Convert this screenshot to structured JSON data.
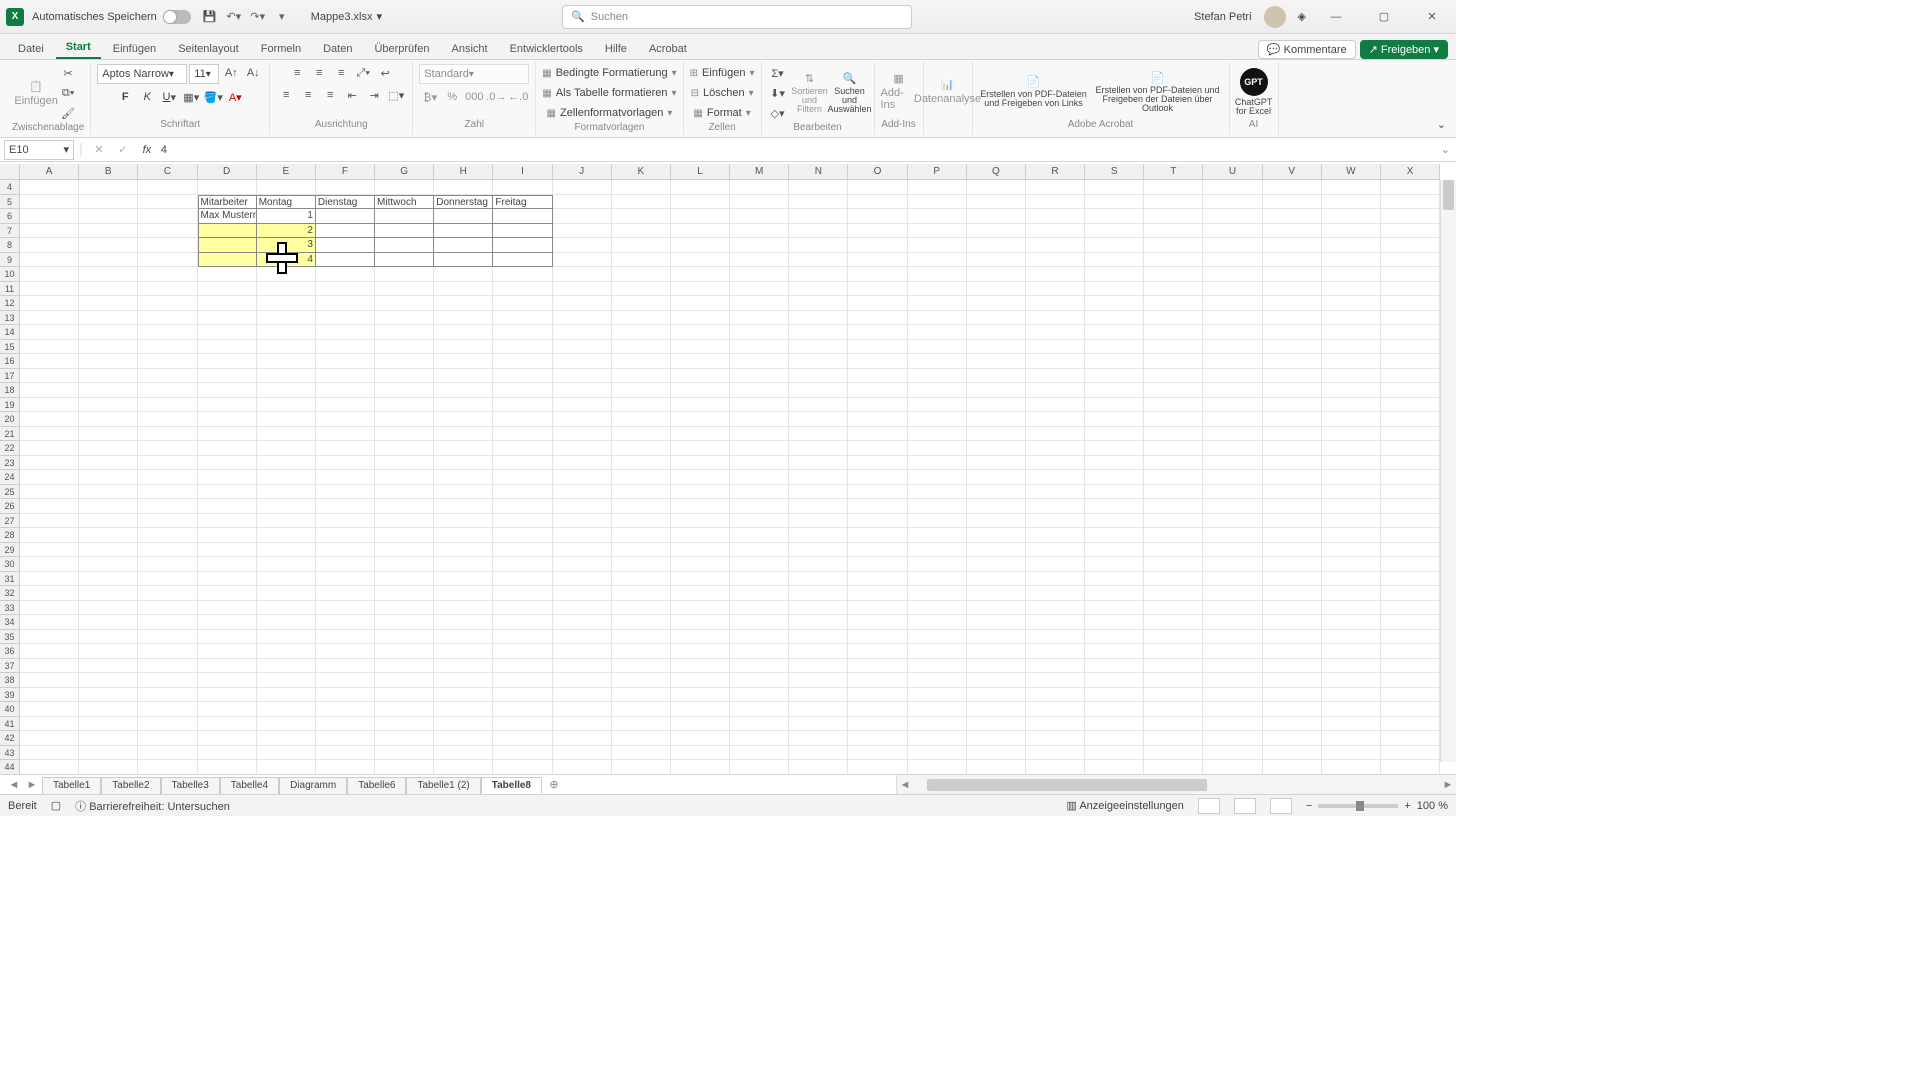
{
  "titlebar": {
    "autosave": "Automatisches Speichern",
    "docname": "Mappe3.xlsx",
    "search_placeholder": "Suchen",
    "user": "Stefan Petri"
  },
  "tabs": {
    "items": [
      "Datei",
      "Start",
      "Einfügen",
      "Seitenlayout",
      "Formeln",
      "Daten",
      "Überprüfen",
      "Ansicht",
      "Entwicklertools",
      "Hilfe",
      "Acrobat"
    ],
    "active": 1,
    "comments": "Kommentare",
    "share": "Freigeben"
  },
  "ribbon": {
    "clipboard": {
      "label": "Zwischenablage",
      "paste": "Einfügen"
    },
    "font": {
      "label": "Schriftart",
      "name": "Aptos Narrow",
      "size": "11"
    },
    "align": {
      "label": "Ausrichtung"
    },
    "number": {
      "label": "Zahl",
      "format": "Standard"
    },
    "styles": {
      "label": "Formatvorlagen",
      "cond": "Bedingte Formatierung",
      "asTable": "Als Tabelle formatieren",
      "cellStyles": "Zellenformatvorlagen"
    },
    "cells": {
      "label": "Zellen",
      "insert": "Einfügen",
      "delete": "Löschen",
      "format": "Format"
    },
    "editing": {
      "label": "Bearbeiten",
      "sortFilter": "Sortieren und Filtern",
      "findSelect": "Suchen und Auswählen"
    },
    "addins": {
      "label": "Add-Ins",
      "addins": "Add-Ins"
    },
    "analysis": {
      "label": "",
      "data": "Datenanalyse"
    },
    "acrobat": {
      "label": "Adobe Acrobat",
      "pdf1": "Erstellen von PDF-Dateien und Freigeben von Links",
      "pdf2": "Erstellen von PDF-Dateien und Freigeben der Dateien über Outlook"
    },
    "ai": {
      "label": "AI",
      "chatgpt": "ChatGPT for Excel"
    }
  },
  "formula": {
    "ref": "E10",
    "value": "4"
  },
  "columns": [
    "A",
    "B",
    "C",
    "D",
    "E",
    "F",
    "G",
    "H",
    "I",
    "J",
    "K",
    "L",
    "M",
    "N",
    "O",
    "P",
    "Q",
    "R",
    "S",
    "T",
    "U",
    "V",
    "W",
    "X"
  ],
  "rowstart": 4,
  "rowcount": 41,
  "table": {
    "headerRow": 5,
    "firstDataRow": 6,
    "lastRow": 9,
    "firstCol": "D",
    "lastCol": "I",
    "headers": [
      "Mitarbeiter",
      "Montag",
      "Dienstag",
      "Mittwoch",
      "Donnerstag",
      "Freitag"
    ],
    "rows": [
      {
        "D": "Max Mustern",
        "E": "1"
      },
      {
        "E": "2"
      },
      {
        "E": "3"
      },
      {
        "E": "4"
      }
    ],
    "highlight": {
      "cols": [
        "D",
        "E"
      ],
      "rows": [
        7,
        8,
        9
      ]
    }
  },
  "sheets": {
    "items": [
      "Tabelle1",
      "Tabelle2",
      "Tabelle3",
      "Tabelle4",
      "Diagramm",
      "Tabelle6",
      "Tabelle1 (2)",
      "Tabelle8"
    ],
    "active": 7
  },
  "status": {
    "ready": "Bereit",
    "a11y": "Barrierefreiheit: Untersuchen",
    "display": "Anzeigeeinstellungen",
    "zoom": "100 %"
  }
}
